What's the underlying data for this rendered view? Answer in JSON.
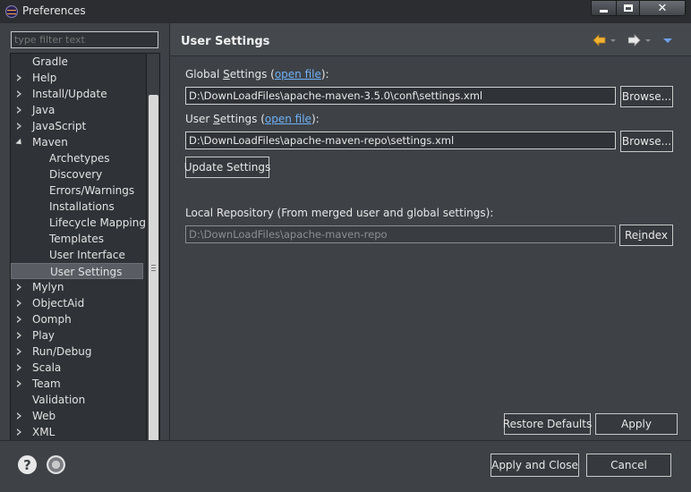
{
  "window": {
    "title": "Preferences"
  },
  "left": {
    "filter_placeholder": "type filter text",
    "tree": [
      {
        "label": "Gradle",
        "indent": 0,
        "expander": "none"
      },
      {
        "label": "Help",
        "indent": 0,
        "expander": "collapsed"
      },
      {
        "label": "Install/Update",
        "indent": 0,
        "expander": "collapsed"
      },
      {
        "label": "Java",
        "indent": 0,
        "expander": "collapsed"
      },
      {
        "label": "JavaScript",
        "indent": 0,
        "expander": "collapsed"
      },
      {
        "label": "Maven",
        "indent": 0,
        "expander": "expanded"
      },
      {
        "label": "Archetypes",
        "indent": 1,
        "expander": "none"
      },
      {
        "label": "Discovery",
        "indent": 1,
        "expander": "none"
      },
      {
        "label": "Errors/Warnings",
        "indent": 1,
        "expander": "none"
      },
      {
        "label": "Installations",
        "indent": 1,
        "expander": "none"
      },
      {
        "label": "Lifecycle Mappings",
        "indent": 1,
        "expander": "none"
      },
      {
        "label": "Templates",
        "indent": 1,
        "expander": "none"
      },
      {
        "label": "User Interface",
        "indent": 1,
        "expander": "none"
      },
      {
        "label": "User Settings",
        "indent": 1,
        "expander": "none",
        "selected": true
      },
      {
        "label": "Mylyn",
        "indent": 0,
        "expander": "collapsed"
      },
      {
        "label": "ObjectAid",
        "indent": 0,
        "expander": "collapsed"
      },
      {
        "label": "Oomph",
        "indent": 0,
        "expander": "collapsed"
      },
      {
        "label": "Play",
        "indent": 0,
        "expander": "collapsed"
      },
      {
        "label": "Run/Debug",
        "indent": 0,
        "expander": "collapsed"
      },
      {
        "label": "Scala",
        "indent": 0,
        "expander": "collapsed"
      },
      {
        "label": "Team",
        "indent": 0,
        "expander": "collapsed"
      },
      {
        "label": "Validation",
        "indent": 0,
        "expander": "none"
      },
      {
        "label": "Web",
        "indent": 0,
        "expander": "collapsed"
      },
      {
        "label": "XML",
        "indent": 0,
        "expander": "collapsed"
      }
    ]
  },
  "page": {
    "title": "User Settings",
    "global_label_pre": "Global ",
    "global_label_mnemonic": "S",
    "global_label_post": "ettings (",
    "global_link": "open file",
    "global_label_end": "):",
    "global_value": "D:\\DownLoadFiles\\apache-maven-3.5.0\\conf\\settings.xml",
    "user_label_pre": "User ",
    "user_label_mnemonic": "S",
    "user_label_post": "ettings (",
    "user_link": "open file",
    "user_label_end": "):",
    "user_value": "D:\\DownLoadFiles\\apache-maven-repo\\settings.xml",
    "browse_label": "Browse...",
    "update_label": "Update Settings",
    "local_repo_label": "Local Repository (From merged user and global settings):",
    "local_repo_value": "D:\\DownLoadFiles\\apache-maven-repo",
    "reindex_pre": "Re",
    "reindex_mnemonic": "i",
    "reindex_post": "ndex",
    "restore_label": "Restore Defaults",
    "apply_label": "Apply"
  },
  "bottom": {
    "apply_close_label": "Apply and Close",
    "cancel_label": "Cancel"
  },
  "colors": {
    "accent_link": "#6fb1f7",
    "nav_back": "#f2b233",
    "nav_forward": "#e8e8e8",
    "menu": "#6fa0e8"
  },
  "icons": {
    "help": "help-icon",
    "record": "record-icon"
  }
}
